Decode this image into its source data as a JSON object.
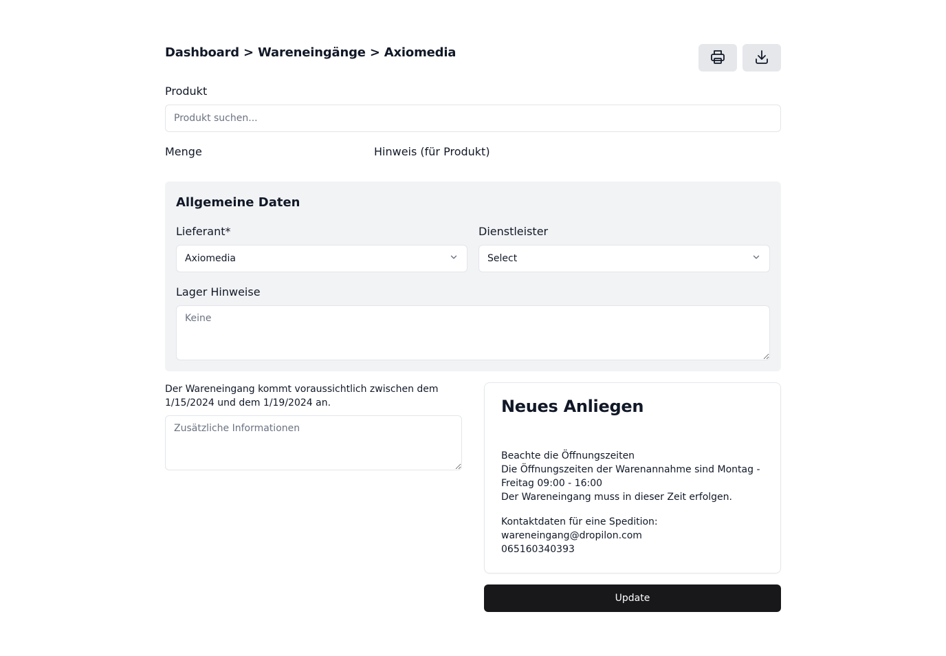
{
  "breadcrumb": "Dashboard > Wareneingänge > Axiomedia",
  "toolbar": {
    "print_icon": "printer-icon",
    "download_icon": "download-icon"
  },
  "produkt": {
    "label": "Produkt",
    "placeholder": "Produkt suchen..."
  },
  "menge": {
    "label": "Menge"
  },
  "hinweis": {
    "label": "Hinweis (für Produkt)"
  },
  "allgemein": {
    "title": "Allgemeine Daten",
    "lieferant": {
      "label": "Lieferant*",
      "value": "Axiomedia"
    },
    "dienstleister": {
      "label": "Dienstleister",
      "value": "Select"
    },
    "lager": {
      "label": "Lager Hinweise",
      "placeholder": "Keine"
    }
  },
  "eta": {
    "line1": "Der Wareneingang kommt voraussichtlich zwischen dem",
    "line2": "1/15/2024 und dem 1/19/2024 an.",
    "placeholder": "Zusätzliche Informationen"
  },
  "card": {
    "title": "Neues Anliegen",
    "hint_title": "Beachte die Öffnungszeiten",
    "hint_line1": "Die Öffnungszeiten der Warenannahme sind Montag -",
    "hint_line2": "Freitag 09:00 - 16:00",
    "hint_line3": "Der Wareneingang muss in dieser Zeit erfolgen.",
    "contact_label": "Kontaktdaten für eine Spedition:",
    "contact_email": "wareneingang@dropilon.com",
    "contact_phone": "065160340393"
  },
  "update_label": "Update",
  "colors": {
    "primary_button": "#18181b",
    "panel_bg": "#f2f3f5",
    "icon_button_bg": "#e5e7eb"
  }
}
